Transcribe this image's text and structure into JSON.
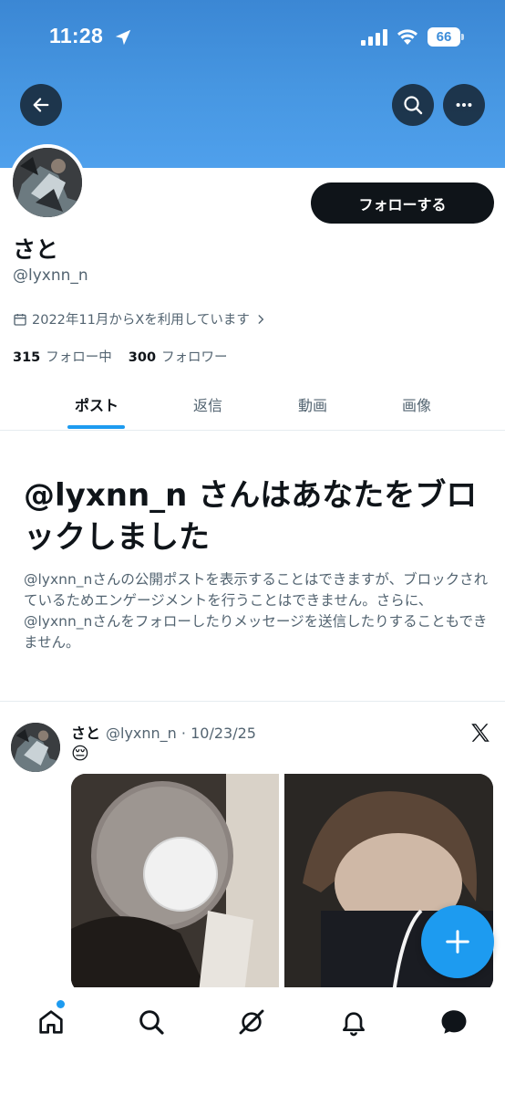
{
  "status_bar": {
    "time": "11:28",
    "battery": "66"
  },
  "profile": {
    "display_name": "さと",
    "handle": "@lyxnn_n",
    "joined": "2022年11月からXを利用しています",
    "following_count": "315",
    "following_label": "フォロー中",
    "followers_count": "300",
    "followers_label": "フォロワー",
    "follow_button": "フォローする"
  },
  "tabs": [
    {
      "label": "ポスト",
      "active": true
    },
    {
      "label": "返信",
      "active": false
    },
    {
      "label": "動画",
      "active": false
    },
    {
      "label": "画像",
      "active": false
    }
  ],
  "blocked": {
    "title": "@lyxnn_n さんはあなたをブロックしました",
    "description": "@lyxnn_nさんの公開ポストを表示することはできますが、ブロックされているためエンゲージメントを行うことはできません。さらに、@lyxnn_nさんをフォローしたりメッセージを送信したりすることもできません。"
  },
  "post": {
    "name": "さと",
    "meta": "@lyxnn_n · 10/23/25",
    "emoji": "😔"
  },
  "icons": {
    "back": "back-arrow-icon",
    "search": "search-icon",
    "more": "more-icon",
    "compose": "plus-icon",
    "nav": [
      "home-icon",
      "search-icon",
      "grok-icon",
      "notifications-icon",
      "messages-icon"
    ]
  },
  "colors": {
    "accent": "#1d9bf0",
    "banner": "#4797e2",
    "text": "#0f1419",
    "muted": "#536471"
  }
}
